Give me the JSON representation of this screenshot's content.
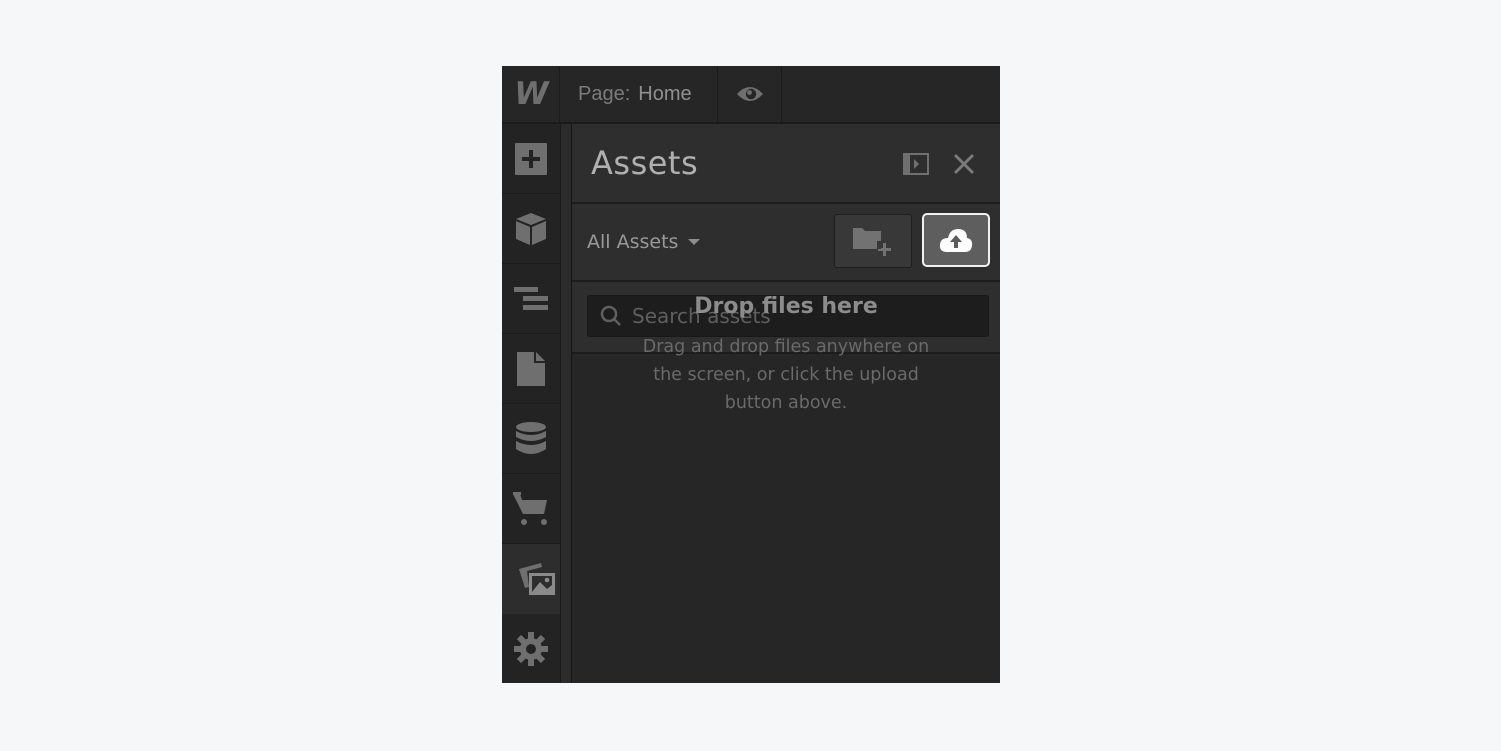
{
  "topbar": {
    "logo": "W",
    "page_label": "Page:",
    "page_name": "Home",
    "preview_icon": "eye-icon"
  },
  "rail": {
    "items": [
      {
        "name": "add-panel",
        "icon": "plus-square-icon",
        "active": false
      },
      {
        "name": "symbols",
        "icon": "cube-icon",
        "active": false
      },
      {
        "name": "navigator",
        "icon": "navigator-icon",
        "active": false
      },
      {
        "name": "pages",
        "icon": "page-icon",
        "active": false
      },
      {
        "name": "cms",
        "icon": "database-icon",
        "active": false
      },
      {
        "name": "ecommerce",
        "icon": "cart-icon",
        "active": false
      },
      {
        "name": "assets",
        "icon": "images-icon",
        "active": true
      },
      {
        "name": "settings",
        "icon": "gear-icon",
        "active": false
      }
    ]
  },
  "panel": {
    "title": "Assets",
    "dock_icon": "dock-panel-icon",
    "close_icon": "close-icon",
    "filter_label": "All Assets",
    "new_folder_icon": "folder-plus-icon",
    "upload_icon": "cloud-upload-icon",
    "search_placeholder": "Search assets",
    "search_value": "",
    "empty_title": "Drop files here",
    "empty_desc": "Drag and drop files anywhere on the screen, or click the upload button above."
  },
  "colors": {
    "background": "#f6f7f8",
    "app_bg": "#232323",
    "panel_bg": "#2e2e2e",
    "icon": "#6f6f6f",
    "upload_button": "#5e5e5e",
    "upload_border": "#f0f0f0"
  }
}
